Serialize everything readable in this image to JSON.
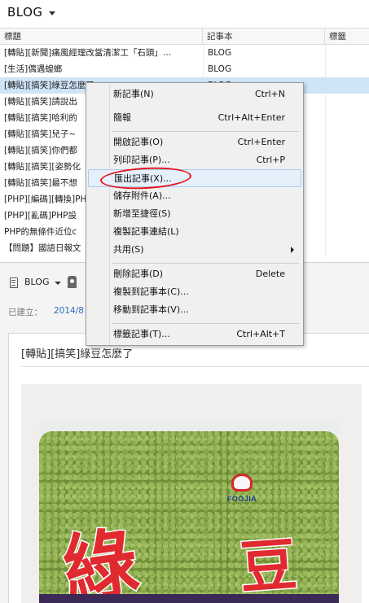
{
  "header": {
    "title": "BLOG"
  },
  "table": {
    "columns": [
      "標題",
      "記事本",
      "標籤"
    ],
    "rows": [
      {
        "title": "[轉貼][新聞]痛風經理改當清潔工「石頭」…",
        "notebook": "BLOG",
        "selected": false
      },
      {
        "title": "[生活]偶遇蝗螂",
        "notebook": "BLOG",
        "selected": false
      },
      {
        "title": "[轉貼][搞笑]綠豆怎麼了",
        "notebook": "BLOG",
        "selected": true
      },
      {
        "title": "[轉貼][搞笑]請說出",
        "notebook": "",
        "selected": false
      },
      {
        "title": "[轉貼][搞笑]哈利的",
        "notebook": "",
        "selected": false
      },
      {
        "title": "[轉貼][搞笑]兒子~",
        "notebook": "",
        "selected": false
      },
      {
        "title": "[轉貼][搞笑]你們都",
        "notebook": "",
        "selected": false
      },
      {
        "title": "[轉貼][搞笑][姿勢化",
        "notebook": "",
        "selected": false
      },
      {
        "title": "[轉貼][搞笑]最不想",
        "notebook": "",
        "selected": false
      },
      {
        "title": "[PHP][編碼][轉換]PH",
        "notebook": "",
        "selected": false
      },
      {
        "title": "[PHP][亂碼]PHP設",
        "notebook": "",
        "selected": false
      },
      {
        "title": "PHP的無條件近位c",
        "notebook": "",
        "selected": false
      },
      {
        "title": "【問題】國語日報文",
        "notebook": "",
        "selected": false
      }
    ]
  },
  "note": {
    "notebook_label": "BLOG",
    "created_label": "已建立：",
    "created_date": "2014/8",
    "title": "[轉貼][搞笑]綠豆怎麼了",
    "image": {
      "logo_text": "FOOJIA",
      "glyph1": "綠",
      "glyph2": "豆"
    }
  },
  "context_menu": {
    "items": [
      {
        "label": "新記事(N)",
        "shortcut": "Ctrl+N"
      },
      {
        "label": "簡報",
        "shortcut": "Ctrl+Alt+Enter"
      },
      {
        "label": "開啟記事(O)",
        "shortcut": "Ctrl+Enter"
      },
      {
        "label": "列印記事(P)...",
        "shortcut": "Ctrl+P"
      },
      {
        "label": "匯出記事(X)...",
        "shortcut": "",
        "highlighted": true
      },
      {
        "label": "儲存附件(A)...",
        "shortcut": ""
      },
      {
        "label": "新增至捷徑(S)",
        "shortcut": ""
      },
      {
        "label": "複製記事連結(L)",
        "shortcut": ""
      },
      {
        "label": "共用(S)",
        "shortcut": "",
        "submenu": true
      },
      {
        "label": "刪除記事(D)",
        "shortcut": "Delete"
      },
      {
        "label": "複製到記事本(C)...",
        "shortcut": ""
      },
      {
        "label": "移動到記事本(V)...",
        "shortcut": ""
      },
      {
        "label": "標籤記事(T)...",
        "shortcut": "Ctrl+Alt+T"
      }
    ]
  },
  "colors": {
    "selection": "#cfe4f7",
    "menu_bg": "#f0f0f0",
    "annotation": "#e5141b",
    "link": "#2a6ebb"
  }
}
